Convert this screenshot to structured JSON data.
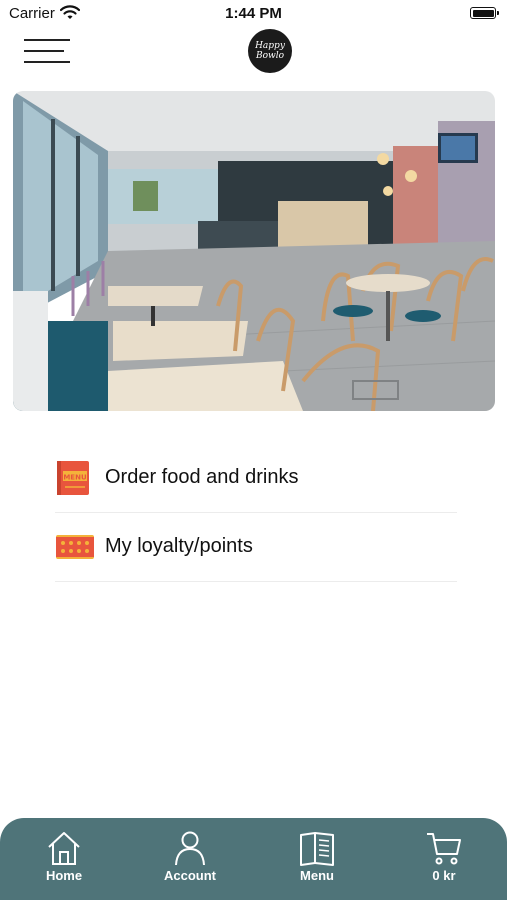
{
  "status_bar": {
    "carrier": "Carrier",
    "time": "1:44 PM"
  },
  "header": {
    "logo_line1": "Happy",
    "logo_line2": "Bowlo"
  },
  "hero": {
    "image": "cafe-interior-photo"
  },
  "menu": {
    "items": [
      {
        "label": "Order food and drinks",
        "icon": "menu-book-icon"
      },
      {
        "label": "My loyalty/points",
        "icon": "loyalty-card-icon"
      }
    ]
  },
  "tabbar": {
    "background": "#4f7479",
    "tabs": [
      {
        "label": "Home",
        "icon": "home-icon"
      },
      {
        "label": "Account",
        "icon": "account-icon"
      },
      {
        "label": "Menu",
        "icon": "menu-book-icon"
      },
      {
        "label": "0 kr",
        "icon": "cart-icon"
      }
    ]
  }
}
